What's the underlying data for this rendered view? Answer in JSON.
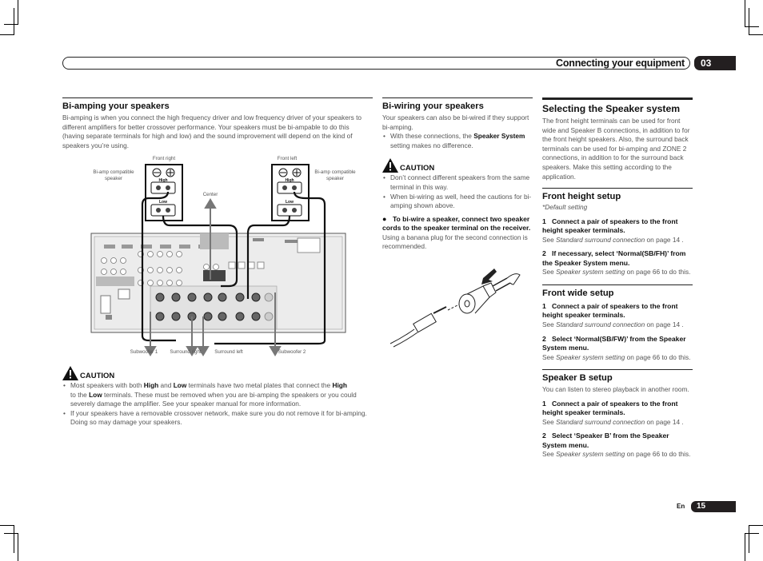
{
  "header": {
    "section_title": "Connecting your equipment",
    "chapter": "03"
  },
  "left": {
    "biamp": {
      "title": "Bi-amping your speakers",
      "body": "Bi-amping is when you connect the high frequency driver and low frequency driver of your speakers to different amplifiers for better crossover performance. Your speakers must be bi-ampable to do this (having separate terminals for high and low) and the sound improvement will depend on the kind of speakers you’re using."
    },
    "diagram": {
      "front_right": "Front right",
      "front_left": "Front left",
      "biamp_speaker_left": "Bi-amp compatible speaker",
      "biamp_speaker_right": "Bi-amp compatible speaker",
      "center": "Center",
      "high": "High",
      "low": "Low",
      "subwoofer1": "Subwoofer 1",
      "surround_right": "Surround right",
      "surround_left": "Surround left",
      "subwoofer2": "Subwoofer 2"
    },
    "caution": {
      "label": "CAUTION",
      "b1_pre": "Most speakers with both ",
      "b1_high": "High",
      "b1_mid": " and ",
      "b1_low": "Low",
      "b1_post": " terminals have two metal plates that connect the ",
      "b1_high2": "High",
      "b1_to": " to the ",
      "b1_low2": "Low",
      "b1_end": " terminals. These must be removed when you are bi-amping the speakers or you could severely damage the amplifier. See your speaker manual for more information.",
      "b2": "If your speakers have a removable crossover network, make sure you do not remove it for bi-amping. Doing so may damage your speakers."
    }
  },
  "middle": {
    "title": "Bi-wiring your speakers",
    "intro": "Your speakers can also be bi-wired if they support bi-amping.",
    "bullet_pre": "With these connections, the ",
    "bullet_bold": "Speaker System",
    "bullet_post": " setting makes no difference.",
    "caution_label": "CAUTION",
    "caution_items": [
      "Don’t connect different speakers from the same terminal in this way.",
      "When bi-wiring as well, heed the cautions for bi-amping shown above."
    ],
    "instruction": "To bi-wire a speaker, connect two speaker cords to the speaker terminal on the receiver.",
    "instruction_note": "Using a banana plug for the second connection is recommended."
  },
  "right": {
    "title": "Selecting the Speaker system",
    "intro": "The front height terminals can be used for front wide and Speaker B connections, in addition to for the front height speakers. Also, the surround back terminals can be used for bi-amping and ZONE 2 connections, in addition to for the surround back speakers. Make this setting according to the application.",
    "sections": [
      {
        "title": "Front height setup",
        "note": "*Default setting",
        "steps": [
          {
            "num": "1",
            "text": "Connect a pair of speakers to the front height speaker terminals.",
            "see_pre": "See ",
            "see_link": "Standard surround connection",
            "see_post": " on page 14 ."
          },
          {
            "num": "2",
            "text": "If necessary, select ‘Normal(SB/FH)’ from the Speaker System menu.",
            "see_pre": "See ",
            "see_link": "Speaker system setting",
            "see_post": " on page 66 to do this."
          }
        ]
      },
      {
        "title": "Front wide setup",
        "steps": [
          {
            "num": "1",
            "text": "Connect a pair of speakers to the front height speaker terminals.",
            "see_pre": "See ",
            "see_link": "Standard surround connection",
            "see_post": " on page 14 ."
          },
          {
            "num": "2",
            "text": "Select ‘Normal(SB/FW)’ from the Speaker System menu.",
            "see_pre": "See ",
            "see_link": "Speaker system setting",
            "see_post": " on page 66 to do this."
          }
        ]
      },
      {
        "title": "Speaker B setup",
        "intro": "You can listen to stereo playback in another room.",
        "steps": [
          {
            "num": "1",
            "text": "Connect a pair of speakers to the front height speaker terminals.",
            "see_pre": "See ",
            "see_link": "Standard surround connection",
            "see_post": " on page 14 ."
          },
          {
            "num": "2",
            "text": "Select ‘Speaker B’ from the Speaker System menu.",
            "see_pre": "See ",
            "see_link": "Speaker system setting",
            "see_post": " on page 66 to do this."
          }
        ]
      }
    ]
  },
  "footer": {
    "lang": "En",
    "page": "15"
  }
}
